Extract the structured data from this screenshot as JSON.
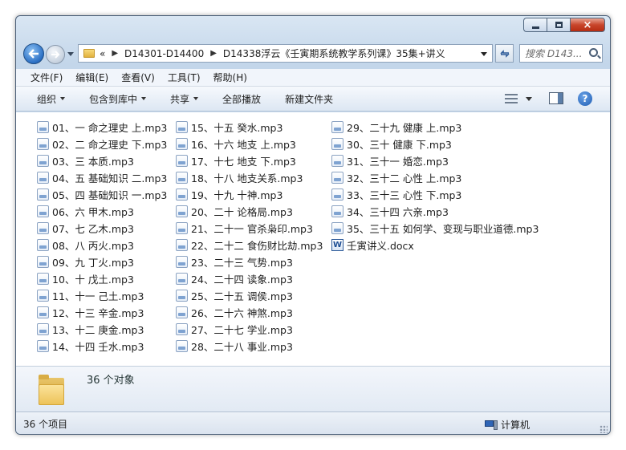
{
  "window": {
    "buttons": {
      "minimize": "minimize",
      "maximize": "maximize",
      "close": "×"
    }
  },
  "address": {
    "overflow_glyph": "«",
    "crumbs": [
      "D14301-D14400",
      "D14338浮云《壬寅期系统教学系列课》35集+讲义"
    ],
    "search_placeholder": "搜索 D143..."
  },
  "menu": [
    "文件(F)",
    "编辑(E)",
    "查看(V)",
    "工具(T)",
    "帮助(H)"
  ],
  "toolbar": {
    "organize": "组织",
    "include_library": "包含到库中",
    "share": "共享",
    "play_all": "全部播放",
    "new_folder": "新建文件夹",
    "help_glyph": "?"
  },
  "files": {
    "col1": [
      "01、一 命之理史 上.mp3",
      "02、二 命之理史 下.mp3",
      "03、三 本质.mp3",
      "04、五 基础知识 二.mp3",
      "05、四 基础知识 一.mp3",
      "06、六 甲木.mp3",
      "07、七 乙木.mp3",
      "08、八 丙火.mp3",
      "09、九 丁火.mp3",
      "10、十 戊土.mp3",
      "11、十一 己土.mp3",
      "12、十三 辛金.mp3",
      "13、十二 庚金.mp3",
      "14、十四 壬水.mp3"
    ],
    "col2": [
      "15、十五 癸水.mp3",
      "16、十六 地支 上.mp3",
      "17、十七 地支 下.mp3",
      "18、十八 地支关系.mp3",
      "19、十九 十神.mp3",
      "20、二十 论格局.mp3",
      "21、二十一 官杀枭印.mp3",
      "22、二十二 食伤财比劫.mp3",
      "23、二十三 气势.mp3",
      "24、二十四 读象.mp3",
      "25、二十五 调侯.mp3",
      "26、二十六 神煞.mp3",
      "27、二十七 学业.mp3",
      "28、二十八 事业.mp3"
    ],
    "col3": [
      "29、二十九 健康 上.mp3",
      "30、三十 健康 下.mp3",
      "31、三十一 婚恋.mp3",
      "32、三十二 心性 上.mp3",
      "33、三十三 心性 下.mp3",
      "34、三十四 六亲.mp3",
      "35、三十五 如何学、变现与职业道德.mp3"
    ],
    "doc": "壬寅讲义.docx",
    "doc_icon_glyph": "W"
  },
  "details": {
    "count": "36 个对象"
  },
  "status": {
    "items": "36 个项目",
    "location": "计算机"
  }
}
